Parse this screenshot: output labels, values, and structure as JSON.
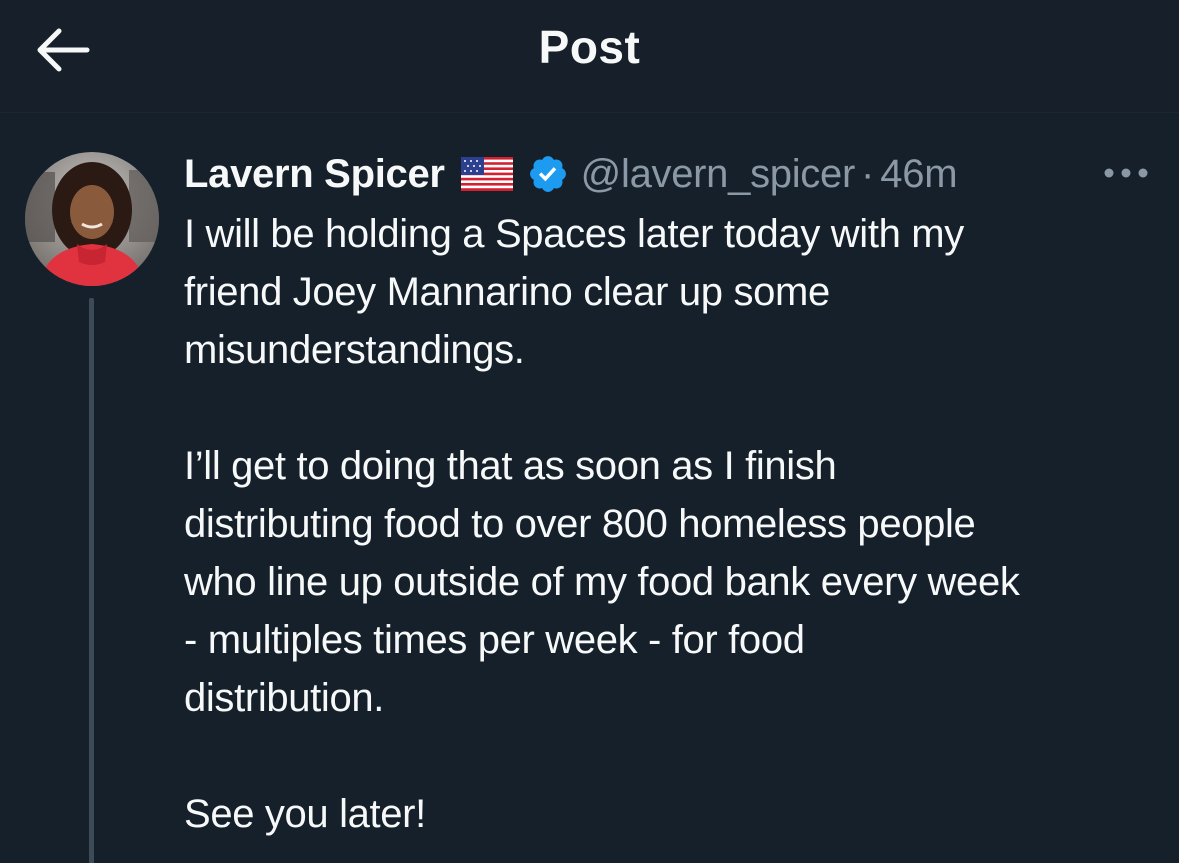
{
  "header": {
    "title": "Post",
    "back_icon": "arrow-left-icon"
  },
  "post": {
    "author": {
      "display_name": "Lavern Spicer",
      "flag_icon": "us-flag-icon",
      "verified_icon": "verified-badge-icon",
      "handle": "@lavern_spicer",
      "separator": "·",
      "time": "46m"
    },
    "more_icon": "more-options-icon",
    "paragraphs": [
      {
        "lines": [
          "I will be holding a Spaces later today with my",
          "friend Joey Mannarino clear up some",
          "misunderstandings."
        ]
      },
      {
        "lines": [
          "I’ll get to doing that as soon as I finish",
          "distributing food to over 800 homeless people",
          "who line up outside of my food bank every week",
          "- multiples times per week - for food",
          "distribution."
        ]
      },
      {
        "lines": [
          "See you later!"
        ]
      }
    ]
  },
  "colors": {
    "background": "#15202b",
    "text": "#f7f9f9",
    "secondary_text": "#8b98a5",
    "verified": "#1d9bf0",
    "thread_line": "#3d4a58"
  }
}
